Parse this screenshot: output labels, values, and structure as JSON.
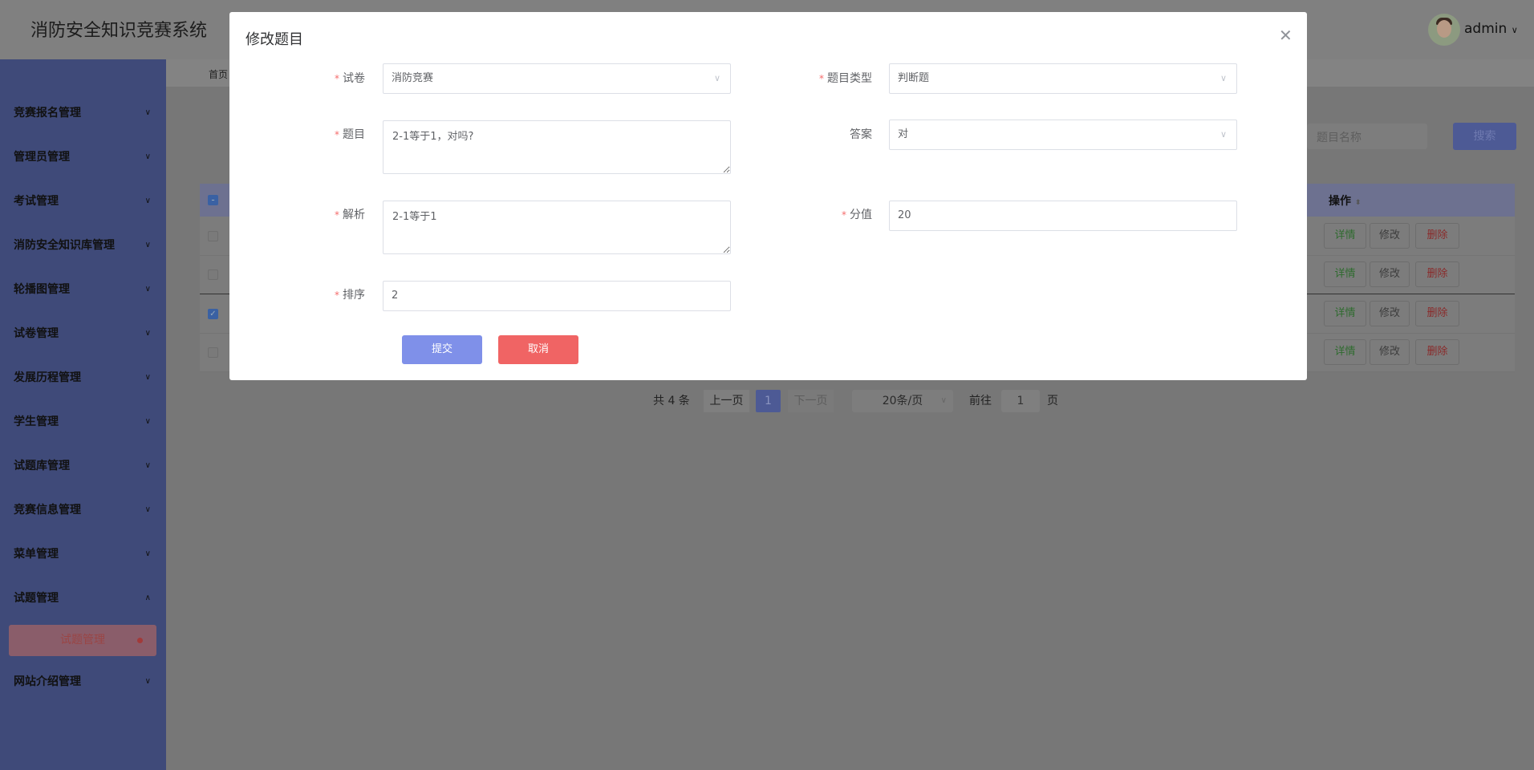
{
  "header": {
    "title": "消防安全知识竞赛系统",
    "user": "admin"
  },
  "sidebar": {
    "items": [
      {
        "label": "竞赛报名管理",
        "expanded": false
      },
      {
        "label": "管理员管理",
        "expanded": false
      },
      {
        "label": "考试管理",
        "expanded": false
      },
      {
        "label": "消防安全知识库管理",
        "expanded": false
      },
      {
        "label": "轮播图管理",
        "expanded": false
      },
      {
        "label": "试卷管理",
        "expanded": false
      },
      {
        "label": "发展历程管理",
        "expanded": false
      },
      {
        "label": "学生管理",
        "expanded": false
      },
      {
        "label": "试题库管理",
        "expanded": false
      },
      {
        "label": "竞赛信息管理",
        "expanded": false
      },
      {
        "label": "菜单管理",
        "expanded": false
      },
      {
        "label": "试题管理",
        "expanded": true
      },
      {
        "label": "网站介绍管理",
        "expanded": false
      }
    ],
    "active_sub": "试题管理"
  },
  "breadcrumb": "首页",
  "search": {
    "placeholder": "题目名称",
    "button": "搜索"
  },
  "table": {
    "action_header": "操作",
    "rows": [
      {
        "checked": false,
        "actions": [
          "详情",
          "修改",
          "删除"
        ]
      },
      {
        "checked": false,
        "actions": [
          "详情",
          "修改",
          "删除"
        ]
      },
      {
        "checked": true,
        "actions": [
          "详情",
          "修改",
          "删除"
        ]
      },
      {
        "checked": false,
        "actions": [
          "详情",
          "修改",
          "删除"
        ]
      }
    ]
  },
  "pagination": {
    "total": "共 4 条",
    "prev": "上一页",
    "page": "1",
    "next": "下一页",
    "size": "20条/页",
    "goto": "前往",
    "goto_value": "1",
    "page_suffix": "页"
  },
  "dialog": {
    "title": "修改题目",
    "fields": {
      "paper": {
        "label": "试卷",
        "value": "消防竞赛"
      },
      "type": {
        "label": "题目类型",
        "value": "判断题"
      },
      "question": {
        "label": "题目",
        "value": "2-1等于1，对吗?"
      },
      "answer": {
        "label": "答案",
        "value": "对"
      },
      "analysis": {
        "label": "解析",
        "value": "2-1等于1"
      },
      "score": {
        "label": "分值",
        "value": "20"
      },
      "order": {
        "label": "排序",
        "value": "2"
      }
    },
    "submit": "提交",
    "cancel": "取消"
  },
  "colors": {
    "sidebar": "#3f4a79",
    "submit": "#7f90e9",
    "cancel": "#f06464",
    "required": "#f56c6c"
  }
}
